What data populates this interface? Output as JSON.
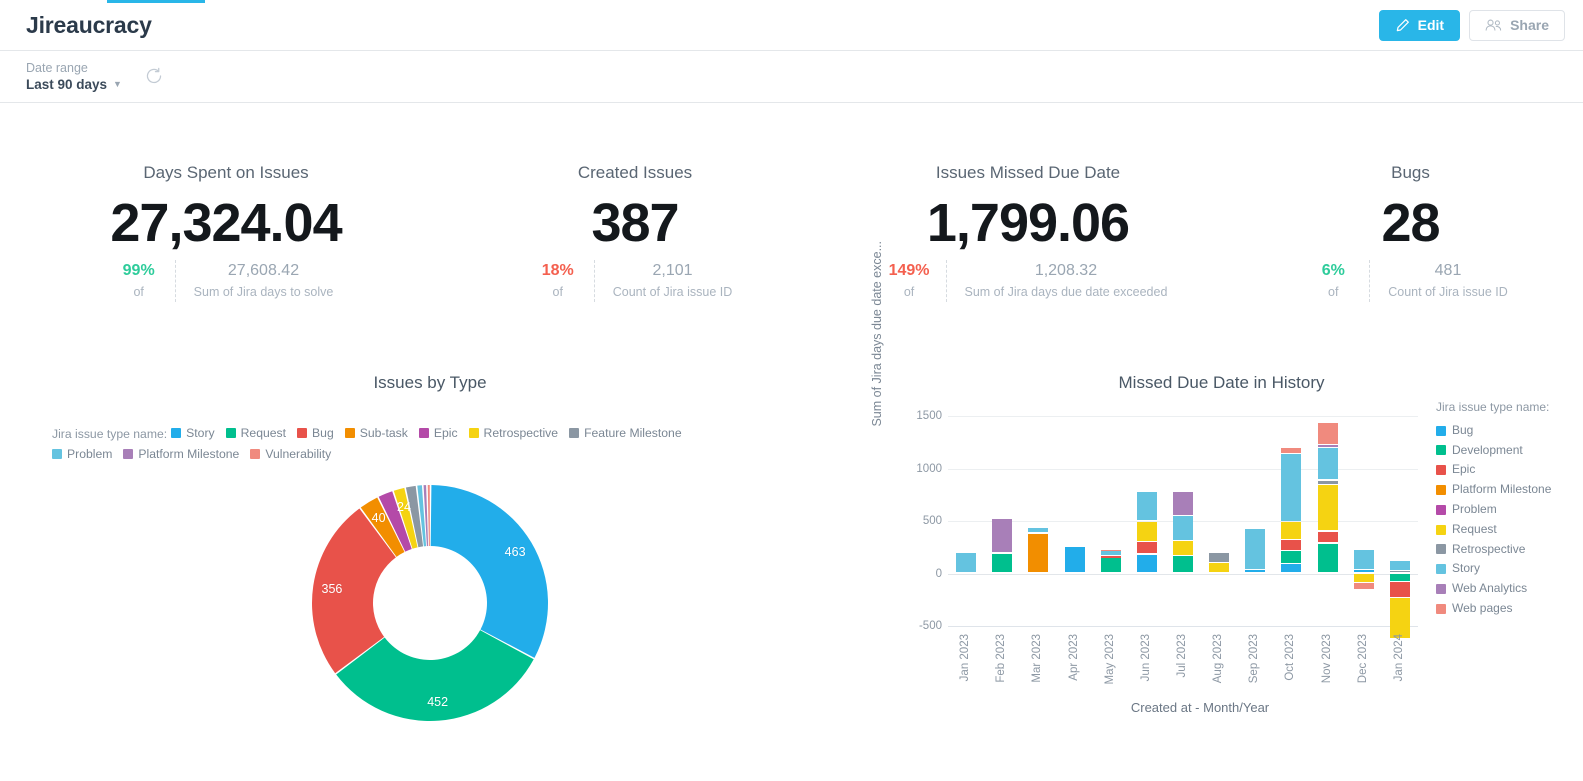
{
  "header": {
    "title": "Jireaucracy",
    "edit_label": "Edit",
    "share_label": "Share"
  },
  "filters": {
    "date_range_label": "Date range",
    "date_range_value": "Last 90 days"
  },
  "kpis": [
    {
      "title": "Days Spent on Issues",
      "value": "27,324.04",
      "percent": "99%",
      "percent_color": "green",
      "of_label": "of",
      "compare_value": "27,608.42",
      "compare_label": "Sum of Jira days to solve"
    },
    {
      "title": "Created Issues",
      "value": "387",
      "percent": "18%",
      "percent_color": "red",
      "of_label": "of",
      "compare_value": "2,101",
      "compare_label": "Count of Jira issue ID"
    },
    {
      "title": "Issues Missed Due Date",
      "value": "1,799.06",
      "percent": "149%",
      "percent_color": "red",
      "of_label": "of",
      "compare_value": "1,208.32",
      "compare_label": "Sum of Jira days due date exceeded"
    },
    {
      "title": "Bugs",
      "value": "28",
      "percent": "6%",
      "percent_color": "green",
      "of_label": "of",
      "compare_value": "481",
      "compare_label": "Count of Jira issue ID"
    }
  ],
  "chart_data": [
    {
      "type": "pie",
      "variant": "donut",
      "title": "Issues by Type",
      "legend_title": "Jira issue type name:",
      "legend_position": "top",
      "labels": [
        "Story",
        "Request",
        "Bug",
        "Sub-task",
        "Epic",
        "Retrospective",
        "Feature Milestone",
        "Problem",
        "Platform Milestone",
        "Vulnerability"
      ],
      "values": [
        463,
        452,
        356,
        40,
        31,
        24,
        22,
        12,
        8,
        7
      ],
      "colors": [
        "#22adea",
        "#00bf8e",
        "#e8524a",
        "#f28e00",
        "#b44aa8",
        "#f5d312",
        "#8b97a3",
        "#64c3e0",
        "#a87fb8",
        "#f08a7e"
      ],
      "shown_labels": [
        {
          "label": "Story",
          "text": "463"
        },
        {
          "label": "Request",
          "text": "452"
        },
        {
          "label": "Bug",
          "text": "356"
        },
        {
          "label": "Sub-task",
          "text": "40"
        },
        {
          "label": "Retrospective",
          "text": "24"
        }
      ]
    },
    {
      "type": "bar",
      "variant": "stacked",
      "title": "Missed Due Date in History",
      "xlabel": "Created at - Month/Year",
      "ylabel": "Sum of Jira days due date exce...",
      "ylim": [
        -500,
        1500
      ],
      "yticks": [
        1500,
        1000,
        500,
        0,
        -500
      ],
      "grid": true,
      "legend_title": "Jira issue type name:",
      "legend_position": "right",
      "categories": [
        "Jan 2023",
        "Feb 2023",
        "Mar 2023",
        "Apr 2023",
        "May 2023",
        "Jun 2023",
        "Jul 2023",
        "Aug 2023",
        "Sep 2023",
        "Oct 2023",
        "Nov 2023",
        "Dec 2023",
        "Jan 2024"
      ],
      "series": [
        {
          "name": "Bug",
          "color": "#22adea",
          "values": [
            0,
            0,
            0,
            255,
            0,
            180,
            0,
            0,
            30,
            90,
            0,
            30,
            0
          ]
        },
        {
          "name": "Development",
          "color": "#00bf8e",
          "values": [
            0,
            190,
            0,
            0,
            150,
            0,
            165,
            0,
            0,
            120,
            285,
            0,
            -80
          ]
        },
        {
          "name": "Epic",
          "color": "#e8524a",
          "values": [
            0,
            0,
            0,
            0,
            15,
            120,
            0,
            0,
            0,
            105,
            115,
            0,
            -155
          ]
        },
        {
          "name": "Platform Milestone",
          "color": "#f28e00",
          "values": [
            0,
            0,
            380,
            0,
            0,
            0,
            0,
            0,
            0,
            0,
            0,
            0,
            0
          ]
        },
        {
          "name": "Problem",
          "color": "#b44aa8",
          "values": [
            0,
            0,
            0,
            0,
            0,
            0,
            0,
            0,
            0,
            0,
            0,
            0,
            0
          ]
        },
        {
          "name": "Request",
          "color": "#f5d312",
          "values": [
            0,
            0,
            0,
            0,
            0,
            195,
            145,
            100,
            0,
            175,
            440,
            -90,
            -395
          ]
        },
        {
          "name": "Retrospective",
          "color": "#8b97a3",
          "values": [
            0,
            0,
            0,
            0,
            0,
            0,
            0,
            100,
            0,
            0,
            45,
            0,
            25
          ]
        },
        {
          "name": "Story",
          "color": "#64c3e0",
          "values": [
            200,
            0,
            55,
            0,
            50,
            280,
            235,
            0,
            395,
            650,
            310,
            190,
            90
          ]
        },
        {
          "name": "Web Analytics",
          "color": "#a87fb8",
          "values": [
            0,
            330,
            0,
            0,
            0,
            0,
            230,
            0,
            0,
            0,
            25,
            0,
            0
          ]
        },
        {
          "name": "Web pages",
          "color": "#f08a7e",
          "values": [
            0,
            0,
            0,
            0,
            10,
            0,
            0,
            0,
            0,
            55,
            215,
            -70,
            0
          ]
        }
      ]
    }
  ]
}
